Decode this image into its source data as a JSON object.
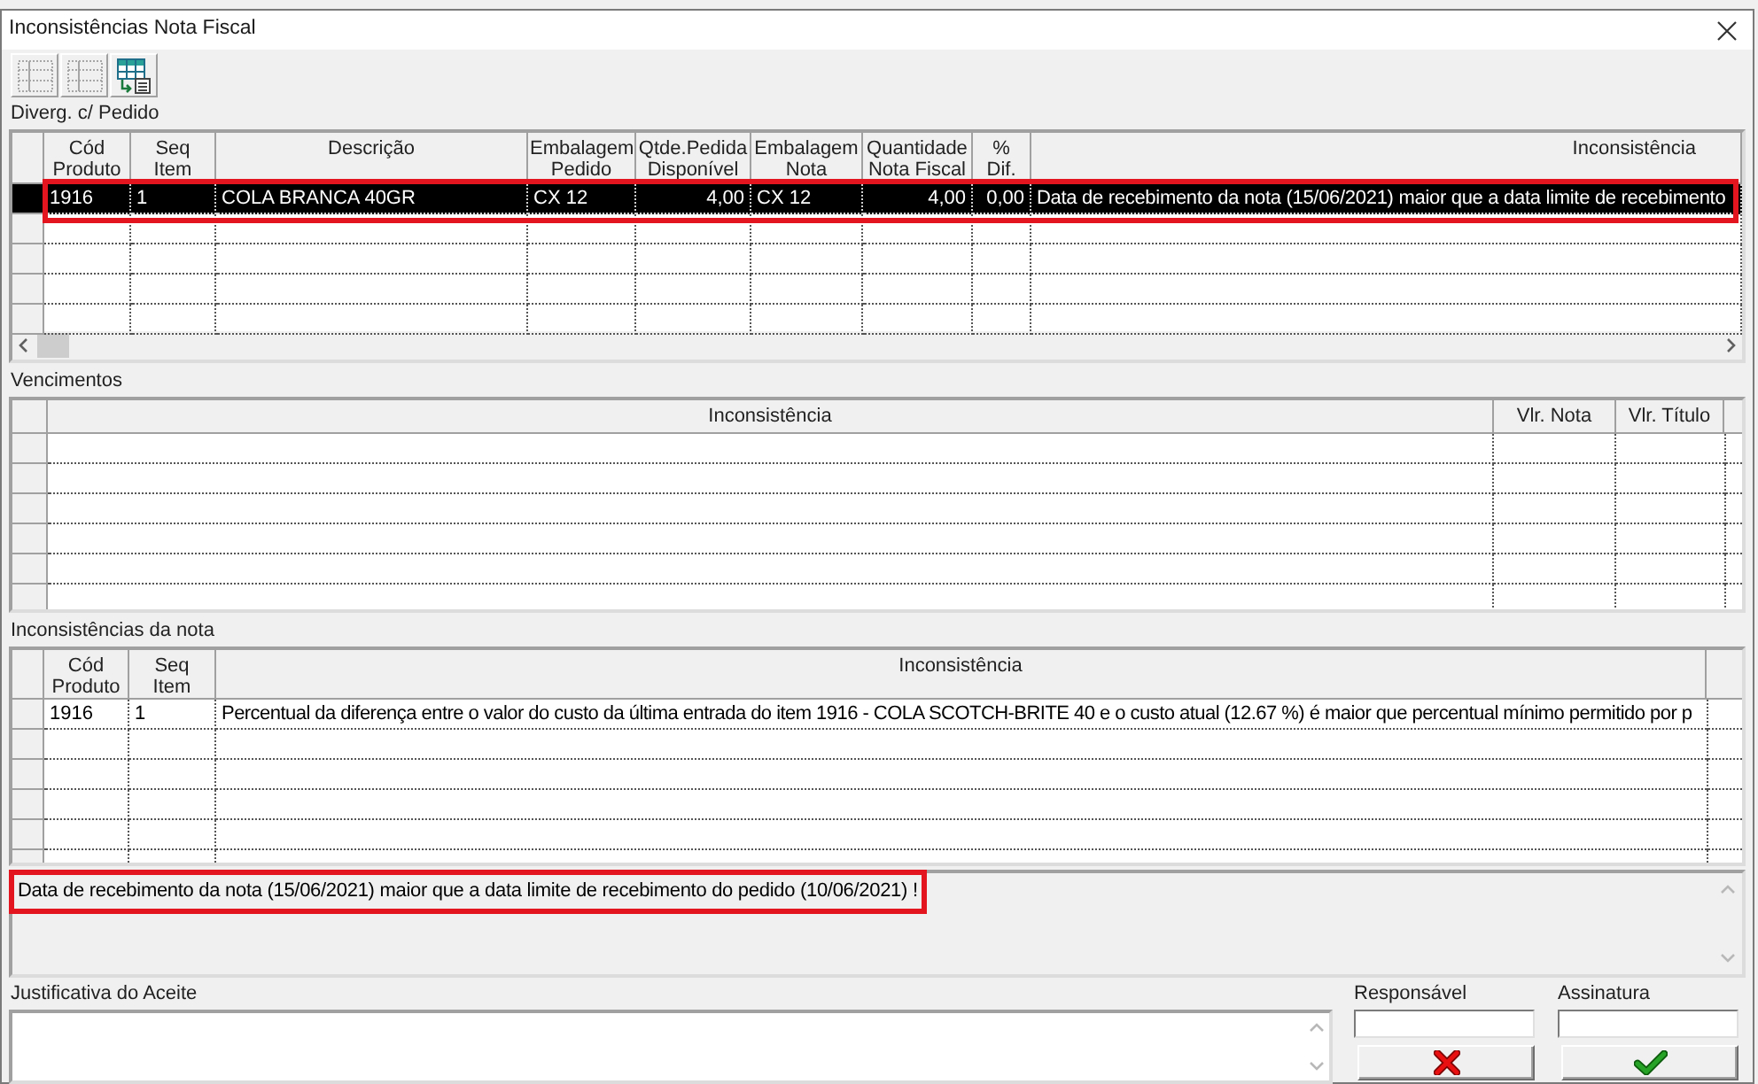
{
  "window": {
    "title": "Inconsistências Nota Fiscal"
  },
  "toolbar": {
    "buttons": [
      {
        "kind": "rows",
        "disabled": true
      },
      {
        "kind": "rows",
        "disabled": true
      },
      {
        "kind": "export",
        "disabled": false
      }
    ]
  },
  "divergences": {
    "label": "Diverg. c/ Pedido",
    "columns": [
      {
        "label": "Cód\nProduto",
        "kind": "text"
      },
      {
        "label": "Seq\nItem",
        "kind": "text"
      },
      {
        "label": "Descrição",
        "kind": "text"
      },
      {
        "label": "Embalagem\nPedido",
        "kind": "text"
      },
      {
        "label": "Qtde.Pedida\nDisponível",
        "kind": "number"
      },
      {
        "label": "Embalagem\nNota",
        "kind": "text"
      },
      {
        "label": "Quantidade\nNota Fiscal",
        "kind": "number"
      },
      {
        "label": "%\nDif.",
        "kind": "number"
      },
      {
        "label": "Inconsistência",
        "kind": "text"
      }
    ],
    "rows": [
      {
        "selected": true,
        "highlighted": true,
        "cells": [
          "1916",
          "1",
          "COLA BRANCA 40GR",
          "CX 12",
          "4,00",
          "CX 12",
          "4,00",
          "0,00",
          "Data de recebimento da nota (15/06/2021) maior que a data limite de recebimento"
        ]
      }
    ]
  },
  "due_dates": {
    "label": "Vencimentos",
    "columns": [
      {
        "label": "Inconsistência"
      },
      {
        "label": "Vlr. Nota"
      },
      {
        "label": "Vlr. Título"
      }
    ]
  },
  "invoice_issues": {
    "label": "Inconsistências da nota",
    "columns": [
      {
        "label": "Cód\nProduto"
      },
      {
        "label": "Seq\nItem"
      },
      {
        "label": "Inconsistência"
      }
    ],
    "rows": [
      {
        "selected": false,
        "cells": [
          "1916",
          "1",
          "Percentual da diferença entre o valor do custo da última entrada do item 1916 - COLA SCOTCH-BRITE 40 e o custo atual (12.67 %) é maior que percentual mínimo permitido por p"
        ]
      }
    ]
  },
  "message": {
    "text": "Data de recebimento da nota (15/06/2021) maior que a data limite de recebimento do pedido (10/06/2021) !",
    "highlighted": true
  },
  "acceptance": {
    "label": "Justificativa do Aceite"
  },
  "responsible": {
    "label": "Responsável"
  },
  "signature": {
    "label": "Assinatura"
  },
  "actions": [
    {
      "kind": "cancel"
    },
    {
      "kind": "confirm"
    }
  ]
}
